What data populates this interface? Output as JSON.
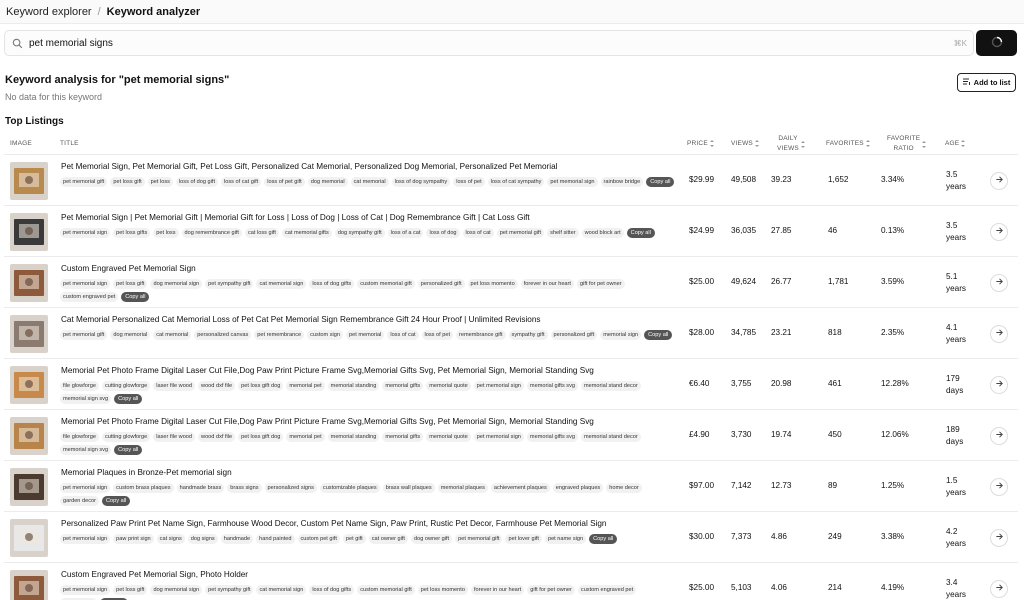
{
  "breadcrumb": {
    "items": [
      "Keyword explorer",
      "Keyword analyzer"
    ],
    "separator": "/"
  },
  "search": {
    "value": "pet memorial signs",
    "shortcut": "⌘K"
  },
  "analysis": {
    "title": "Keyword analysis for \"pet memorial signs\"",
    "subtitle": "No data for this keyword",
    "add_to_list": "Add to list"
  },
  "listings": {
    "heading": "Top Listings",
    "columns": {
      "image": "IMAGE",
      "title": "TITLE",
      "price": "PRICE",
      "views": "VIEWS",
      "daily_views_1": "DAILY",
      "daily_views_2": "VIEWS",
      "favorites": "FAVORITES",
      "fav_ratio_1": "FAVORITE",
      "fav_ratio_2": "RATIO",
      "age": "AGE"
    },
    "copy_label": "Copy all",
    "rows": [
      {
        "title": "Pet Memorial Sign, Pet Memorial Gift, Pet Loss Gift, Personalized Cat Memorial, Personalized Dog Memorial, Personalized Pet Memorial",
        "tags": [
          "pet memorial gift",
          "pet loss gift",
          "pet loss",
          "loss of dog gift",
          "loss of cat gift",
          "loss of pet gift",
          "dog memorial",
          "cat memorial",
          "loss of dog sympathy",
          "loss of pet",
          "loss of cat sympathy",
          "pet memorial sign",
          "rainbow bridge"
        ],
        "price": "$29.99",
        "views": "49,508",
        "daily": "39.23",
        "favorites": "1,652",
        "ratio": "3.34%",
        "age1": "3.5",
        "age2": "years",
        "thumb": "#b98a4e"
      },
      {
        "title": "Pet Memorial Sign | Pet Memorial Gift | Memorial Gift for Loss | Loss of Dog | Loss of Cat | Dog Remembrance Gift | Cat Loss Gift",
        "tags": [
          "pet memorial sign",
          "pet loss gifts",
          "pet loss",
          "dog remembrance gift",
          "cat loss gift",
          "cat memorial gifts",
          "dog sympathy gift",
          "loss of a cat",
          "loss of dog",
          "loss of cat",
          "pet memorial gift",
          "shelf sitter",
          "wood block art"
        ],
        "price": "$24.99",
        "views": "36,035",
        "daily": "27.85",
        "favorites": "46",
        "ratio": "0.13%",
        "age1": "3.5",
        "age2": "years",
        "thumb": "#3a3a3a"
      },
      {
        "title": "Custom Engraved Pet Memorial Sign",
        "tags": [
          "pet memorial sign",
          "pet loss gift",
          "dog memorial sign",
          "pet sympathy gift",
          "cat memorial sign",
          "loss of dog gifts",
          "custom memorial gift",
          "personalized gift",
          "pet loss momento",
          "forever in our heart",
          "gift for pet owner",
          "custom engraved pet"
        ],
        "price": "$25.00",
        "views": "49,624",
        "daily": "26.77",
        "favorites": "1,781",
        "ratio": "3.59%",
        "age1": "5.1",
        "age2": "years",
        "thumb": "#8e5a3c"
      },
      {
        "title": "Cat Memorial Personalized Cat Memorial Loss of Pet Cat Pet Memorial Sign Remembrance Gift 24 Hour Proof | Unlimited Revisions",
        "tags": [
          "pet memorial gift",
          "dog memorial",
          "cat memorial",
          "personalized canvas",
          "pet remembrance",
          "custom sign",
          "pet memorial",
          "loss of cat",
          "loss of pet",
          "remembrance gift",
          "sympathy gift",
          "personalized gift",
          "memorial sign"
        ],
        "price": "$28.00",
        "views": "34,785",
        "daily": "23.21",
        "favorites": "818",
        "ratio": "2.35%",
        "age1": "4.1",
        "age2": "years",
        "thumb": "#8a7a70"
      },
      {
        "title": "Memorial Pet Photo Frame Digital Laser Cut File,Dog Paw Print Picture Frame Svg,Memorial Gifts Svg, Pet Memorial Sign, Memorial Standing Svg",
        "tags": [
          "file glowforge",
          "cutting glowforge",
          "laser file wood",
          "wood dxf file",
          "pet loss gift dog",
          "memorial pet",
          "memorial standing",
          "memorial gifts",
          "memorial quote",
          "pet memorial sign",
          "memorial gifts svg",
          "memorial stand decor",
          "memorial sign svg"
        ],
        "price": "€6.40",
        "views": "3,755",
        "daily": "20.98",
        "favorites": "461",
        "ratio": "12.28%",
        "age1": "179",
        "age2": "days",
        "thumb": "#c78a4a"
      },
      {
        "title": "Memorial Pet Photo Frame Digital Laser Cut File,Dog Paw Print Picture Frame Svg,Memorial Gifts Svg, Pet Memorial Sign, Memorial Standing Svg",
        "tags": [
          "file glowforge",
          "cutting glowforge",
          "laser file wood",
          "wood dxf file",
          "pet loss gift dog",
          "memorial pet",
          "memorial standing",
          "memorial gifts",
          "memorial quote",
          "pet memorial sign",
          "memorial gifts svg",
          "memorial stand decor",
          "memorial sign svg"
        ],
        "price": "£4.90",
        "views": "3,730",
        "daily": "19.74",
        "favorites": "450",
        "ratio": "12.06%",
        "age1": "189",
        "age2": "days",
        "thumb": "#b9844a"
      },
      {
        "title": "Memorial Plaques in Bronze-Pet memorial sign",
        "tags": [
          "pet memorial sign",
          "custom brass plaques",
          "handmade brass",
          "brass signs",
          "personalized signs",
          "customizable plaques",
          "brass wall plaques",
          "memorial plaques",
          "achievement plaques",
          "engraved plaques",
          "home decor",
          "garden decor"
        ],
        "price": "$97.00",
        "views": "7,142",
        "daily": "12.73",
        "favorites": "89",
        "ratio": "1.25%",
        "age1": "1.5",
        "age2": "years",
        "thumb": "#4a3a30"
      },
      {
        "title": "Personalized Paw Print Pet Name Sign, Farmhouse Wood Decor, Custom Pet Name Sign, Paw Print, Rustic Pet Decor, Farmhouse Pet Memorial Sign",
        "tags": [
          "pet memorial sign",
          "paw print sign",
          "cat signs",
          "dog signs",
          "handmade",
          "hand painted",
          "custom pet gift",
          "pet gift",
          "cat owner gift",
          "dog owner gift",
          "pet memorial gift",
          "pet lover gift",
          "pet name sign"
        ],
        "price": "$30.00",
        "views": "7,373",
        "daily": "4.86",
        "favorites": "249",
        "ratio": "3.38%",
        "age1": "4.2",
        "age2": "years",
        "thumb": "#e8e8e8"
      },
      {
        "title": "Custom Engraved Pet Memorial Sign, Photo Holder",
        "tags": [
          "pet memorial sign",
          "pet loss gift",
          "dog memorial sign",
          "pet sympathy gift",
          "cat memorial sign",
          "loss of dog gifts",
          "custom memorial gift",
          "pet loss momento",
          "forever in our heart",
          "gift for pet owner",
          "custom engraved pet",
          "photo holder"
        ],
        "price": "$25.00",
        "views": "5,103",
        "daily": "4.06",
        "favorites": "214",
        "ratio": "4.19%",
        "age1": "3.4",
        "age2": "years",
        "thumb": "#8e5a3c"
      }
    ]
  }
}
